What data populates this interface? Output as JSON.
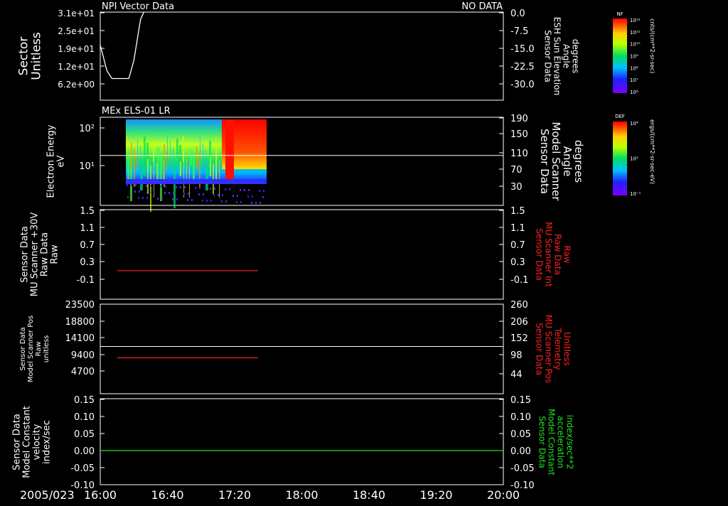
{
  "colors": {
    "background": "#000000",
    "axis": "#ffffff",
    "red_trace": "#ff2020",
    "green_trace": "#20e020",
    "white_trace": "#ffffff"
  },
  "x_axis": {
    "date_label": "2005/023",
    "ticks": [
      "16:00",
      "16:40",
      "17:20",
      "18:00",
      "18:40",
      "19:20",
      "20:00"
    ]
  },
  "chart_data": [
    {
      "type": "line",
      "title": "NPI Vector Data",
      "status": "NO DATA",
      "ylabel": [
        "Sector",
        "Unitless"
      ],
      "y_ticks": [
        "3.1e+01",
        "2.5e+01",
        "1.9e+01",
        "1.2e+01",
        "6.2e+00"
      ],
      "y_right_label": [
        "Sensor Data",
        "ESH Sun Elevation",
        "Angle",
        "degrees"
      ],
      "y_right_ticks": [
        "0.0",
        "-7.5",
        "-15.0",
        "-22.5",
        "-30.0"
      ],
      "series": [
        {
          "x": [
            "16:00",
            "16:02",
            "16:04",
            "16:07",
            "16:17",
            "16:20",
            "16:22",
            "16:24",
            "16:26"
          ],
          "values": [
            17,
            12,
            7,
            4,
            4,
            11,
            19,
            27,
            31
          ]
        }
      ]
    },
    {
      "type": "heatmap",
      "title": "MEx ELS-01 LR",
      "ylabel": [
        "Electron Energy",
        "eV"
      ],
      "y_ticks": [
        "10²",
        "10¹"
      ],
      "y_right_label": [
        "Sensor Data",
        "Model Scanner",
        "Angle",
        "degrees"
      ],
      "y_right_ticks": [
        "190",
        "150",
        "110",
        "70",
        "30"
      ],
      "data_range_x": [
        "16:13",
        "17:34"
      ],
      "reference_line_value": 102
    },
    {
      "type": "line",
      "ylabel": [
        "Sensor Data",
        "MU Scanner +30V",
        "Raw Data",
        "Raw"
      ],
      "y_ticks": [
        "1.5",
        "1.1",
        "0.7",
        "0.3",
        "-0.1"
      ],
      "y_right_label": [
        "Sensor Data",
        "MU Scanner Int",
        "Raw Data",
        "Raw"
      ],
      "y_right_ticks": [
        "1.5",
        "1.1",
        "0.7",
        "0.3",
        "-0.1"
      ],
      "series": [
        {
          "x": [
            "16:10",
            "17:34"
          ],
          "values": [
            0.0,
            0.0
          ]
        }
      ]
    },
    {
      "type": "line",
      "ylabel": [
        "Sensor Data",
        "Model Scanner Pos",
        "Raw",
        "unitless"
      ],
      "y_ticks": [
        "23500",
        "18800",
        "14100",
        "9400",
        "4700"
      ],
      "y_right_label": [
        "Sensor Data",
        "MU Scanner Pos",
        "Telemetry",
        "Unitless"
      ],
      "y_right_ticks": [
        "260",
        "206",
        "152",
        "98",
        "44"
      ],
      "series": [
        {
          "x": [
            "16:10",
            "17:34"
          ],
          "values": [
            8400,
            8400
          ]
        },
        {
          "x": [
            "16:00",
            "20:00"
          ],
          "values": [
            11600,
            11600
          ]
        }
      ]
    },
    {
      "type": "line",
      "ylabel": [
        "Sensor Data",
        "Model Constant",
        "velocity",
        "index/sec"
      ],
      "y_ticks": [
        "0.15",
        "0.10",
        "0.05",
        "0.00",
        "-0.05",
        "-0.10"
      ],
      "y_right_label": [
        "Sensor Data",
        "Model Constant",
        "acceleration",
        "index/sec**2"
      ],
      "y_right_ticks": [
        "0.15",
        "0.10",
        "0.05",
        "0.00",
        "-0.05",
        "-0.10"
      ],
      "series": [
        {
          "x": [
            "16:00",
            "20:00"
          ],
          "values": [
            0.0,
            0.0
          ]
        }
      ]
    }
  ],
  "colorbars": [
    {
      "label": "NF",
      "unit": "cnts/(cm**2-sr-sec)",
      "ticks": [
        "10¹²",
        "10¹¹",
        "10¹⁰",
        "10⁹",
        "10⁸",
        "10⁷",
        "10⁶"
      ]
    },
    {
      "label": "DEF",
      "unit": "ergs/(cm**2-sr-sec-eV)",
      "ticks": [
        "10⁴",
        "10¹",
        "10⁻¹"
      ]
    }
  ]
}
